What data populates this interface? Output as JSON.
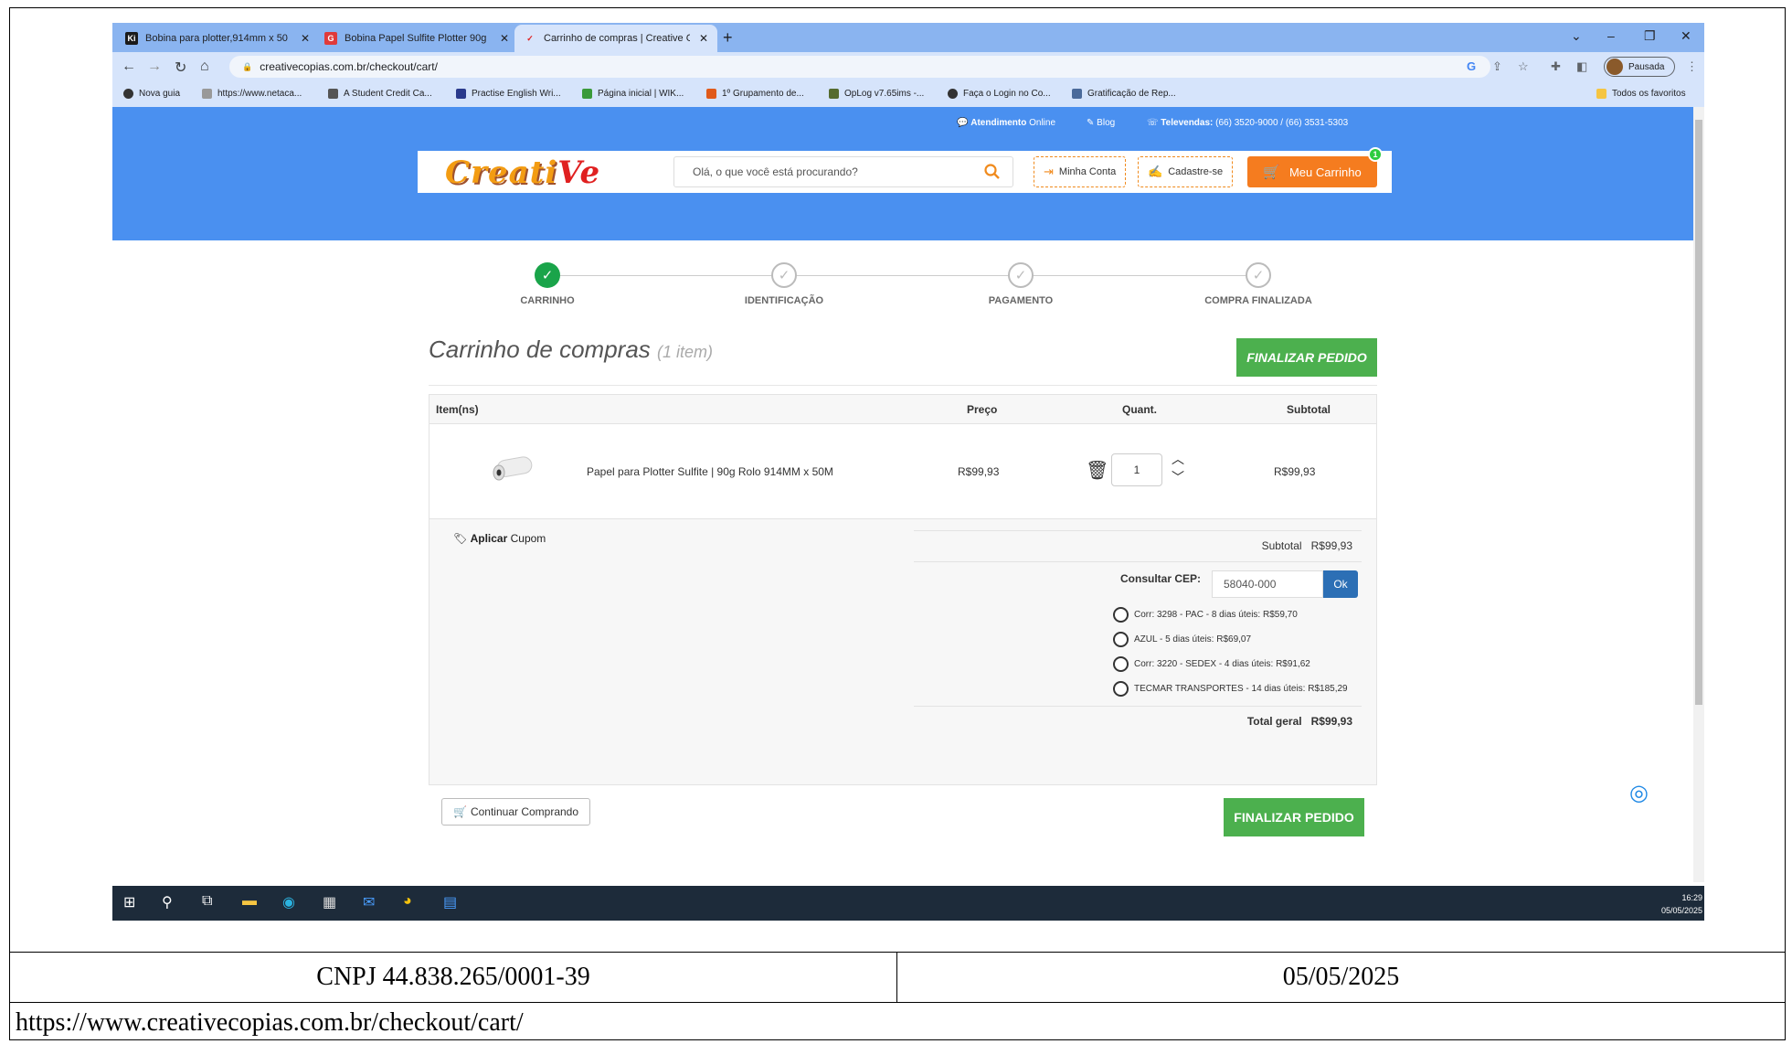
{
  "browser": {
    "tabs": [
      {
        "title": "Bobina para plotter,914mm x 50",
        "favicon": "Ki"
      },
      {
        "title": "Bobina Papel Sulfite Plotter 90g",
        "favicon": "G"
      },
      {
        "title": "Carrinho de compras | Creative C",
        "favicon": "✓"
      }
    ],
    "url": "creativecopias.com.br/checkout/cart/",
    "profile_label": "Pausada",
    "bookmarks": [
      "Nova guia",
      "https://www.netaca...",
      "A Student Credit Ca...",
      "Practise English Wri...",
      "Página inicial | WIK...",
      "1º Grupamento de...",
      "OpLog v7.65ims -...",
      "Faça o Login no Co...",
      "Gratificação de Rep..."
    ],
    "bookmarks_folder": "Todos os favoritos"
  },
  "site": {
    "topbar": {
      "atendimento_bold": "Atendimento",
      "atendimento_rest": " Online",
      "blog": "Blog",
      "televendas_bold": "Televendas:",
      "televendas_rest": " (66) 3520-9000 / (66) 3531-5303"
    },
    "logo_text": "Creati",
    "logo_v": "Ve",
    "search_placeholder": "Olá, o que você está procurando?",
    "minha_conta": "Minha Conta",
    "cadastre": "Cadastre-se",
    "meu_carrinho": "Meu Carrinho",
    "cart_count": "1"
  },
  "steps": [
    "CARRINHO",
    "IDENTIFICAÇÃO",
    "PAGAMENTO",
    "COMPRA FINALIZADA"
  ],
  "cart": {
    "title": "Carrinho de compras",
    "count_label": "(1 item)",
    "finalizar_top": "FINALIZAR PEDIDO",
    "headers": {
      "item": "Item(ns)",
      "preco": "Preço",
      "quant": "Quant.",
      "subtotal": "Subtotal"
    },
    "item": {
      "name": "Papel para Plotter Sulfite | 90g Rolo 914MM x 50M",
      "price": "R$99,93",
      "qty": "1",
      "subtotal": "R$99,93"
    },
    "coupon_bold": "Aplicar",
    "coupon_rest": " Cupom",
    "subtotal_label": "Subtotal",
    "subtotal_value": "R$99,93",
    "cep_label": "Consultar CEP:",
    "cep_value": "58040-000",
    "cep_ok": "Ok",
    "shipping": [
      "Corr: 3298 - PAC - 8 dias úteis: R$59,70",
      "AZUL - 5 dias úteis: R$69,07",
      "Corr: 3220 - SEDEX - 4 dias úteis: R$91,62",
      "TECMAR TRANSPORTES - 14 dias úteis: R$185,29"
    ],
    "total_label": "Total geral",
    "total_value": "R$99,93",
    "continuar": "Continuar Comprando",
    "finalizar_bottom": "FINALIZAR PEDIDO"
  },
  "taskbar": {
    "time": "16:29",
    "date": "05/05/2025"
  },
  "footer": {
    "cnpj": "CNPJ 44.838.265/0001-39",
    "date": "05/05/2025",
    "url": "https://www.creativecopias.com.br/checkout/cart/"
  }
}
